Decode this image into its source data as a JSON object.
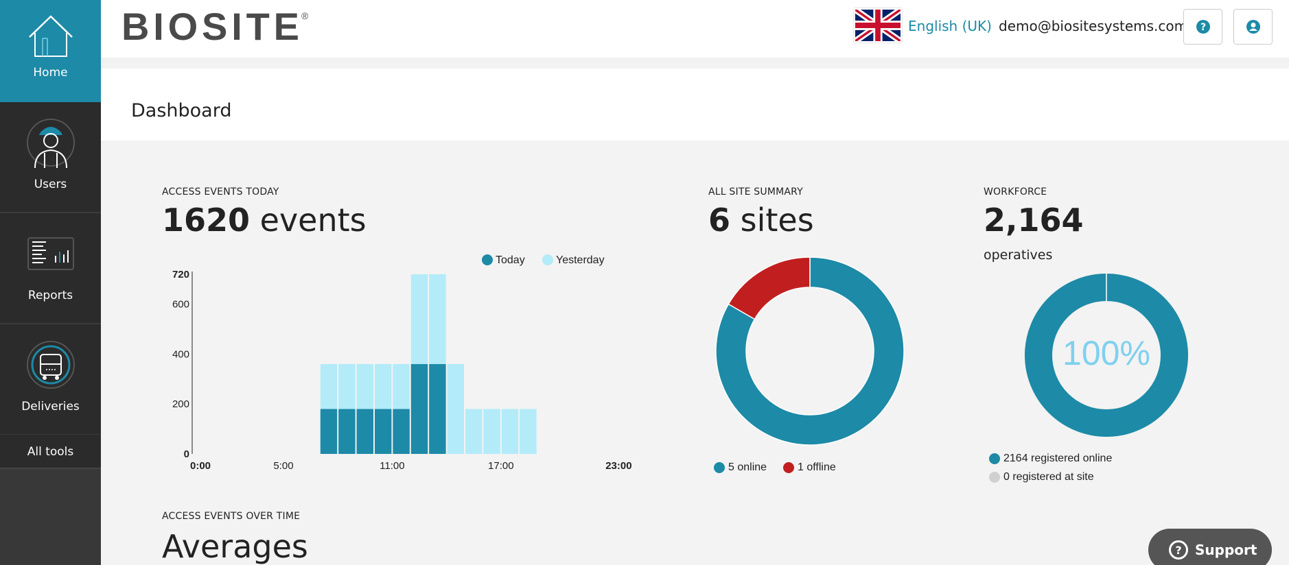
{
  "sidebar": {
    "items": [
      {
        "label": "Home",
        "icon": "home-icon"
      },
      {
        "label": "Users",
        "icon": "worker-icon"
      },
      {
        "label": "Reports",
        "icon": "report-icon"
      },
      {
        "label": "Deliveries",
        "icon": "truck-icon"
      }
    ],
    "all_tools": "All tools"
  },
  "header": {
    "logo_text": "BIOSITE",
    "logo_mark": "®",
    "language": "English (UK)",
    "email": "demo@biositesystems.com",
    "help_icon": "help-icon",
    "account_icon": "account-icon"
  },
  "page": {
    "title": "Dashboard"
  },
  "access_today": {
    "label": "ACCESS EVENTS TODAY",
    "count": "1620",
    "unit": "events"
  },
  "site_summary": {
    "label": "ALL SITE SUMMARY",
    "count": "6",
    "unit": "sites",
    "legend_online": "5 online",
    "legend_offline": "1 offline"
  },
  "workforce": {
    "label": "WORKFORCE",
    "count": "2,164",
    "unit": "operatives",
    "percent": "100%",
    "legend_online": "2164 registered online",
    "legend_site": "0 registered at site"
  },
  "over_time": {
    "label": "ACCESS EVENTS OVER TIME",
    "heading": "Averages"
  },
  "support": {
    "label": "Support"
  },
  "colors": {
    "accent": "#1d8aa7",
    "light": "#b3ebf9",
    "offline": "#c11f1f",
    "grey": "#d0d0d0"
  },
  "chart_data": [
    {
      "type": "bar",
      "legend": [
        "Today",
        "Yesterday"
      ],
      "y_ticks": [
        "0",
        "200",
        "400",
        "600",
        "720"
      ],
      "x_ticks": [
        "0:00",
        "5:00",
        "11:00",
        "17:00",
        "23:00"
      ],
      "ylim": [
        0,
        720
      ],
      "hours": [
        7,
        8,
        9,
        10,
        11,
        12,
        13,
        14,
        15,
        16,
        17,
        18
      ],
      "series": [
        {
          "name": "Today",
          "values": [
            180,
            180,
            180,
            180,
            180,
            360,
            360,
            0,
            0,
            0,
            0,
            0
          ]
        },
        {
          "name": "Yesterday",
          "values": [
            360,
            360,
            360,
            360,
            360,
            720,
            720,
            360,
            180,
            180,
            180,
            180
          ]
        }
      ]
    },
    {
      "type": "pie",
      "slices": [
        {
          "label": "online",
          "value": 5
        },
        {
          "label": "offline",
          "value": 1
        }
      ]
    },
    {
      "type": "pie",
      "slices": [
        {
          "label": "registered online",
          "value": 2164
        },
        {
          "label": "registered at site",
          "value": 0
        }
      ]
    }
  ]
}
